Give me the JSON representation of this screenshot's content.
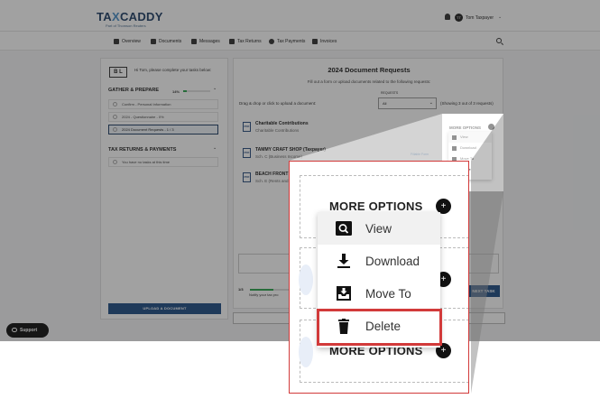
{
  "header": {
    "logo": {
      "tax": "TA",
      "x": "X",
      "caddy": "CADDY"
    },
    "logo_subtitle": "Part of Thomson Reuters",
    "avatar_initials": "TT",
    "user_name": "Tom Taxpayer"
  },
  "nav": {
    "items": [
      {
        "label": "Overview",
        "icon": "home-icon"
      },
      {
        "label": "Documents",
        "icon": "documents-icon"
      },
      {
        "label": "Messages",
        "icon": "messages-icon"
      },
      {
        "label": "Tax Returns",
        "icon": "tax-returns-icon"
      },
      {
        "label": "Tax Payments",
        "icon": "dollar-icon"
      },
      {
        "label": "Invoices",
        "icon": "invoice-icon"
      }
    ]
  },
  "sidebar": {
    "brand_initials": "B L",
    "greeting": "Hi Tom, please complete your tasks below:",
    "gather_title": "GATHER & PREPARE",
    "gather_percent": "14%",
    "gather_progress": 0.14,
    "tasks": [
      {
        "label": "Confirm - Personal Information"
      },
      {
        "label": "2024 - Questionnaire - 0%"
      },
      {
        "label": "2024 Document Requests - 1 / 3"
      }
    ],
    "returns_title": "TAX RETURNS & PAYMENTS",
    "returns_empty": "You have no tasks at this time",
    "upload_button": "UPLOAD A DOCUMENT"
  },
  "main": {
    "title": "2024 Document Requests",
    "subtitle": "Fill out a form or upload documents related to the following requests:",
    "drag_label": "Drag & drop or click to upload a document:",
    "requests_label": "REQUESTS",
    "requests_value": "All",
    "showing": "(Showing 3 out of 3 requests)",
    "documents": [
      {
        "title": "Charitable Contributions",
        "subtitle": "Charitable Contributions"
      },
      {
        "title": "TAMMY CRAFT SHOP (Taxpayer)",
        "subtitle": "Sch. C (Business Income)"
      },
      {
        "title": "BEACH FRONT",
        "subtitle": "Sch. E (Rents and ..."
      }
    ],
    "fillable": "Fillable Form",
    "step": "1/3",
    "notify": "Notify your tax pro",
    "next_button": "NEXT TASK"
  },
  "more_options": {
    "label": "MORE OPTIONS",
    "menu": [
      {
        "label": "View",
        "icon": "view-icon"
      },
      {
        "label": "Download",
        "icon": "download-icon"
      },
      {
        "label": "Move To",
        "icon": "move-to-icon"
      },
      {
        "label": "Delete",
        "icon": "delete-icon"
      }
    ]
  },
  "support": {
    "label": "Support"
  },
  "colors": {
    "brand": "#1f3f66",
    "accent": "#1f4e86",
    "highlight": "#d23a3a",
    "progress": "#2ea44f"
  }
}
